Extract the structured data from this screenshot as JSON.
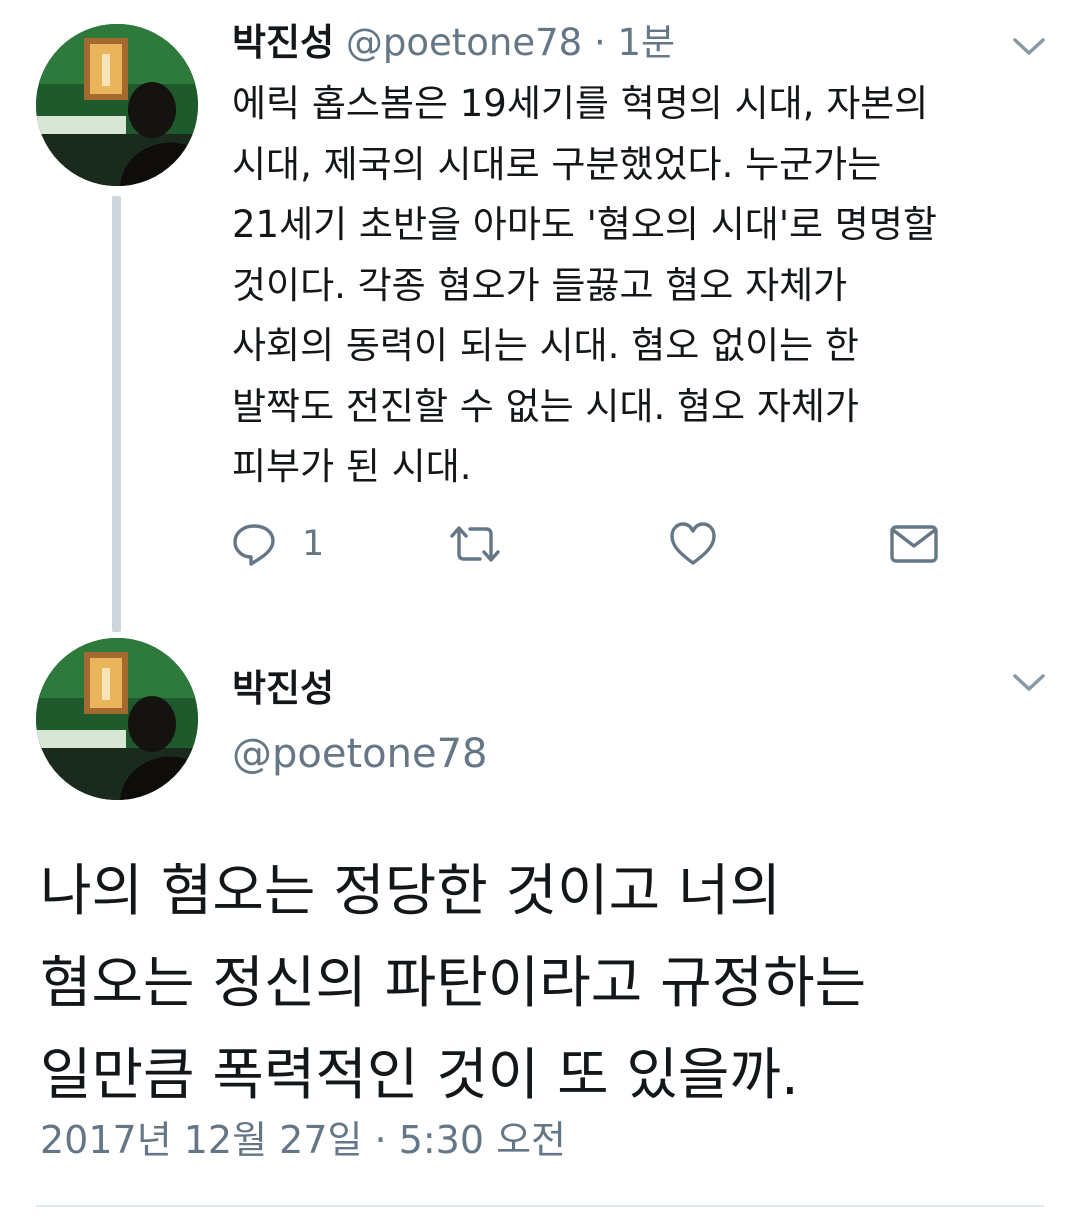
{
  "tweet1": {
    "name": "박진성",
    "handle": "@poetone78",
    "separator": "·",
    "time_ago": "1분",
    "text_lines": [
      "에릭 홉스봄은 19세기를 혁명의 시대, 자본의",
      "시대, 제국의 시대로 구분했었다. 누군가는",
      "21세기 초반을 아마도 '혐오의 시대'로 명명할",
      "것이다. 각종 혐오가 들끓고 혐오 자체가",
      "사회의 동력이 되는 시대. 혐오 없이는 한",
      "발짝도 전진할 수 없는 시대. 혐오 자체가",
      "피부가 된 시대."
    ],
    "reply_count": "1",
    "icons": [
      "reply-icon",
      "retweet-icon",
      "like-icon",
      "message-icon",
      "chevron-down-icon"
    ]
  },
  "tweet2": {
    "name": "박진성",
    "handle": "@poetone78",
    "text_lines": [
      "나의 혐오는 정당한 것이고 너의",
      "혐오는 정신의 파탄이라고 규정하는",
      "일만큼 폭력적인 것이 또 있을까."
    ],
    "timestamp": "2017년 12월 27일 · 5:30 오전"
  },
  "colors": {
    "text": "#14171a",
    "secondary": "#657786",
    "thread_line": "#ccd6dd",
    "divider": "#e1e8ed"
  }
}
